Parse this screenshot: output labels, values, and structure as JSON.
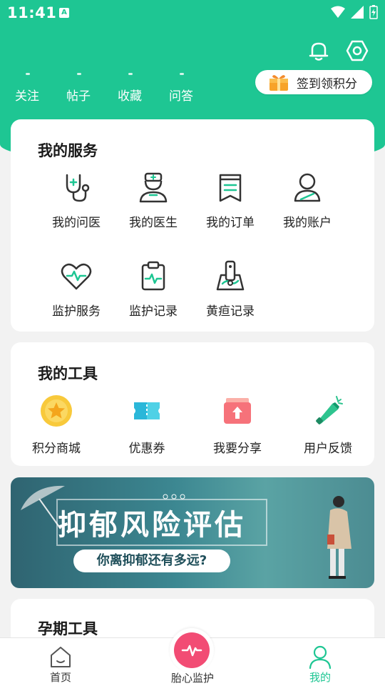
{
  "status_bar": {
    "time": "11:41",
    "badge": "A"
  },
  "profile_stats": [
    {
      "label": "关注"
    },
    {
      "label": "帖子"
    },
    {
      "label": "收藏"
    },
    {
      "label": "问答"
    }
  ],
  "checkin": {
    "label": "签到领积分",
    "icon": "gift-icon"
  },
  "header_icons": [
    "bell-icon",
    "settings-icon"
  ],
  "services": {
    "title": "我的服务",
    "items": [
      {
        "label": "我的问医",
        "icon": "stethoscope-icon"
      },
      {
        "label": "我的医生",
        "icon": "doctor-icon"
      },
      {
        "label": "我的订单",
        "icon": "order-icon"
      },
      {
        "label": "我的账户",
        "icon": "account-icon"
      },
      {
        "label": "监护服务",
        "icon": "heart-monitor-icon"
      },
      {
        "label": "监护记录",
        "icon": "clipboard-icon"
      },
      {
        "label": "黄疸记录",
        "icon": "map-pin-icon"
      }
    ]
  },
  "tools": {
    "title": "我的工具",
    "items": [
      {
        "label": "积分商城",
        "icon": "star-coin-icon"
      },
      {
        "label": "优惠券",
        "icon": "coupon-icon"
      },
      {
        "label": "我要分享",
        "icon": "share-box-icon"
      },
      {
        "label": "用户反馈",
        "icon": "megaphone-icon"
      }
    ]
  },
  "banner": {
    "title": "抑郁风险评估",
    "subtitle": "你离抑郁还有多远?"
  },
  "pregnancy_tools": {
    "title": "孕期工具"
  },
  "bottom_nav": [
    {
      "label": "首页",
      "icon": "home-icon",
      "active": false
    },
    {
      "label": "胎心监护",
      "icon": "heartbeat-icon",
      "active": false
    },
    {
      "label": "我的",
      "icon": "person-icon",
      "active": true
    }
  ],
  "colors": {
    "brand": "#1ec693",
    "active_nav": "#1ec693",
    "accent_pink": "#f24c74"
  }
}
